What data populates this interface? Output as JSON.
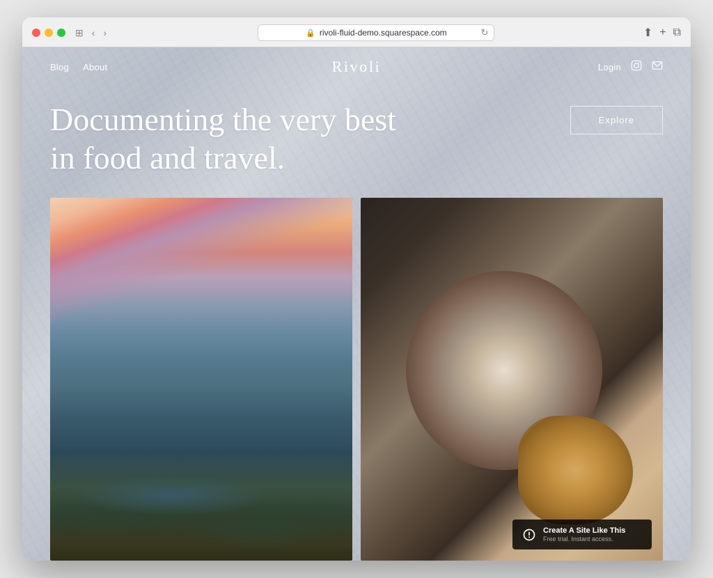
{
  "browser": {
    "url": "rivoli-fluid-demo.squarespace.com",
    "reload_icon": "↻",
    "back_icon": "‹",
    "forward_icon": "›",
    "share_icon": "⬆",
    "add_tab_icon": "+",
    "tab_icon": "⧉",
    "sidebar_icon": "⊞",
    "lock_icon": "🔒"
  },
  "nav": {
    "left_links": [
      {
        "label": "Blog",
        "href": "#"
      },
      {
        "label": "About",
        "href": "#"
      }
    ],
    "brand": "Rivoli",
    "login_label": "Login",
    "instagram_icon": "📷",
    "email_icon": "✉"
  },
  "hero": {
    "headline": "Documenting the very best in food and travel.",
    "explore_button": "Explore"
  },
  "images": [
    {
      "id": "coastal",
      "alt": "Coastal landscape with cliffs and ocean at sunset"
    },
    {
      "id": "coffee",
      "alt": "Overhead view of espresso cup and croissant on marble surface"
    }
  ],
  "squarespace": {
    "title": "Create A Site Like This",
    "subtitle": "Free trial. Instant access."
  }
}
